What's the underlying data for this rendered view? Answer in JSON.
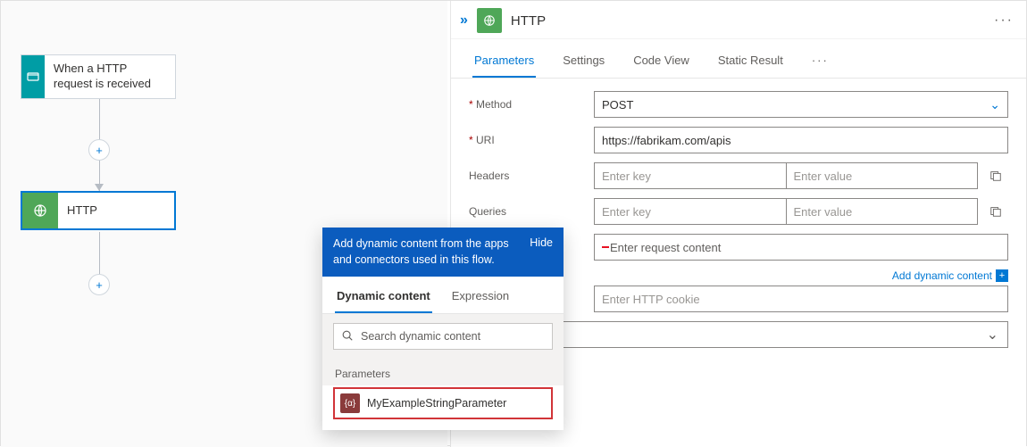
{
  "canvas": {
    "trigger_label": "When a HTTP request is received",
    "http_label": "HTTP"
  },
  "panel": {
    "title": "HTTP",
    "tabs": {
      "parameters": "Parameters",
      "settings": "Settings",
      "code_view": "Code View",
      "static_result": "Static Result",
      "more": "···"
    },
    "labels": {
      "method": "Method",
      "uri": "URI",
      "headers": "Headers",
      "queries": "Queries"
    },
    "required_marker": "*",
    "method_value": "POST",
    "uri_value": "https://fabrikam.com/apis",
    "placeholders": {
      "key": "Enter key",
      "value": "Enter value",
      "body": "Enter request content",
      "cookie": "Enter HTTP cookie"
    },
    "add_dynamic_label": "Add dynamic content"
  },
  "popup": {
    "header_msg": "Add dynamic content from the apps and connectors used in this flow.",
    "hide_label": "Hide",
    "tabs": {
      "dynamic": "Dynamic content",
      "expression": "Expression"
    },
    "search_placeholder": "Search dynamic content",
    "group_label": "Parameters",
    "param_name": "MyExampleStringParameter"
  }
}
